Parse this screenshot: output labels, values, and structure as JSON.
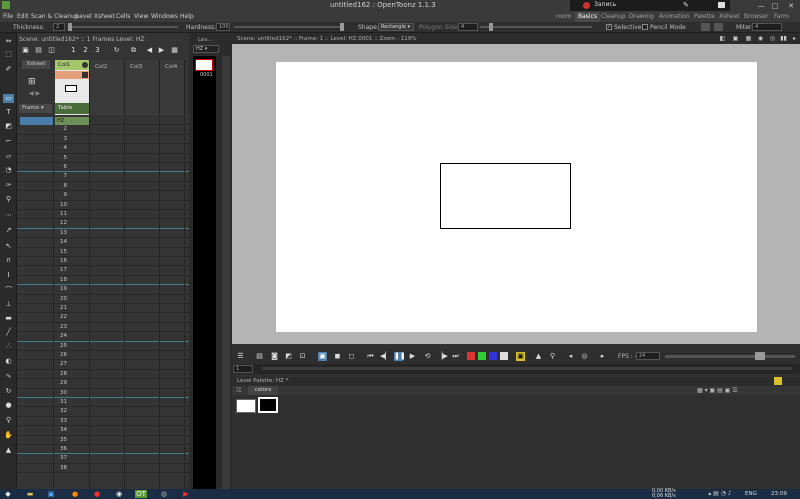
{
  "window": {
    "title": "untitled162 : OpenToonz 1.1.3",
    "min": "—",
    "max": "□",
    "close": "✕"
  },
  "recorder": {
    "label": "Запись"
  },
  "menu": [
    "File",
    "Edit",
    "Scan & Cleanup",
    "Level",
    "Xsheet",
    "Cells",
    "View",
    "Windows",
    "Help"
  ],
  "rooms": [
    "room",
    "Basics",
    "Cleanup",
    "Drawing",
    "Animation",
    "Palette",
    "Xsheet",
    "Browser",
    "Farm"
  ],
  "active_room": "Basics",
  "tool_options": {
    "thickness_label": "Thickness:",
    "thickness_value": "2",
    "hardness_label": "Hardness:",
    "hardness_value": "100",
    "shape_label": "Shape:",
    "shape_value": "Rectangle ▾",
    "polygon_label": "Polygon Sides:",
    "polygon_value": "4",
    "selective_label": "Selective",
    "pencil_label": "Pencil Mode",
    "miter_label": "Miter:",
    "miter_value": "4"
  },
  "xsheet": {
    "header": "Scene: untitled162*  ::  1 Frames Level: HZ",
    "xsheet_button": "Xsheet",
    "columns": [
      "Col1",
      "Col2",
      "Col3",
      "Col4"
    ],
    "table_label": "Table",
    "frame_label": "Frame ▾",
    "cell_label": "HZ",
    "frames": [
      "1",
      "2",
      "3",
      "4",
      "5",
      "6",
      "7",
      "8",
      "9",
      "10",
      "11",
      "12",
      "13",
      "14",
      "15",
      "16",
      "17",
      "18",
      "19",
      "20",
      "21",
      "22",
      "23",
      "24",
      "25",
      "26",
      "27",
      "28",
      "29",
      "30",
      "31",
      "32",
      "33",
      "34",
      "35",
      "36",
      "37",
      "38"
    ]
  },
  "level_strip": {
    "label": "Lev...",
    "dropdown": "HZ ▾",
    "frame_number": "0001"
  },
  "viewer": {
    "title": "Scene: untitled162*  ::  Frame: 1  ::  Level: HZ:0001  ::  Zoom : 119%"
  },
  "playbar": {
    "fps_label": "FPS : --",
    "fps_value": "24",
    "frame_value": "1"
  },
  "palette": {
    "title": "Level Palette: HZ *",
    "tab": "colors"
  },
  "taskbar": {
    "speed_down": "0,00 KB/s",
    "speed_up": "0,06 KB/s",
    "lang": "ENG",
    "time": "23:09"
  },
  "colors": {
    "accent": "#4d7fa8",
    "col1_green": "#a5c66b",
    "col1_orange": "#e3a07a",
    "cell_green": "#6f8f58"
  }
}
